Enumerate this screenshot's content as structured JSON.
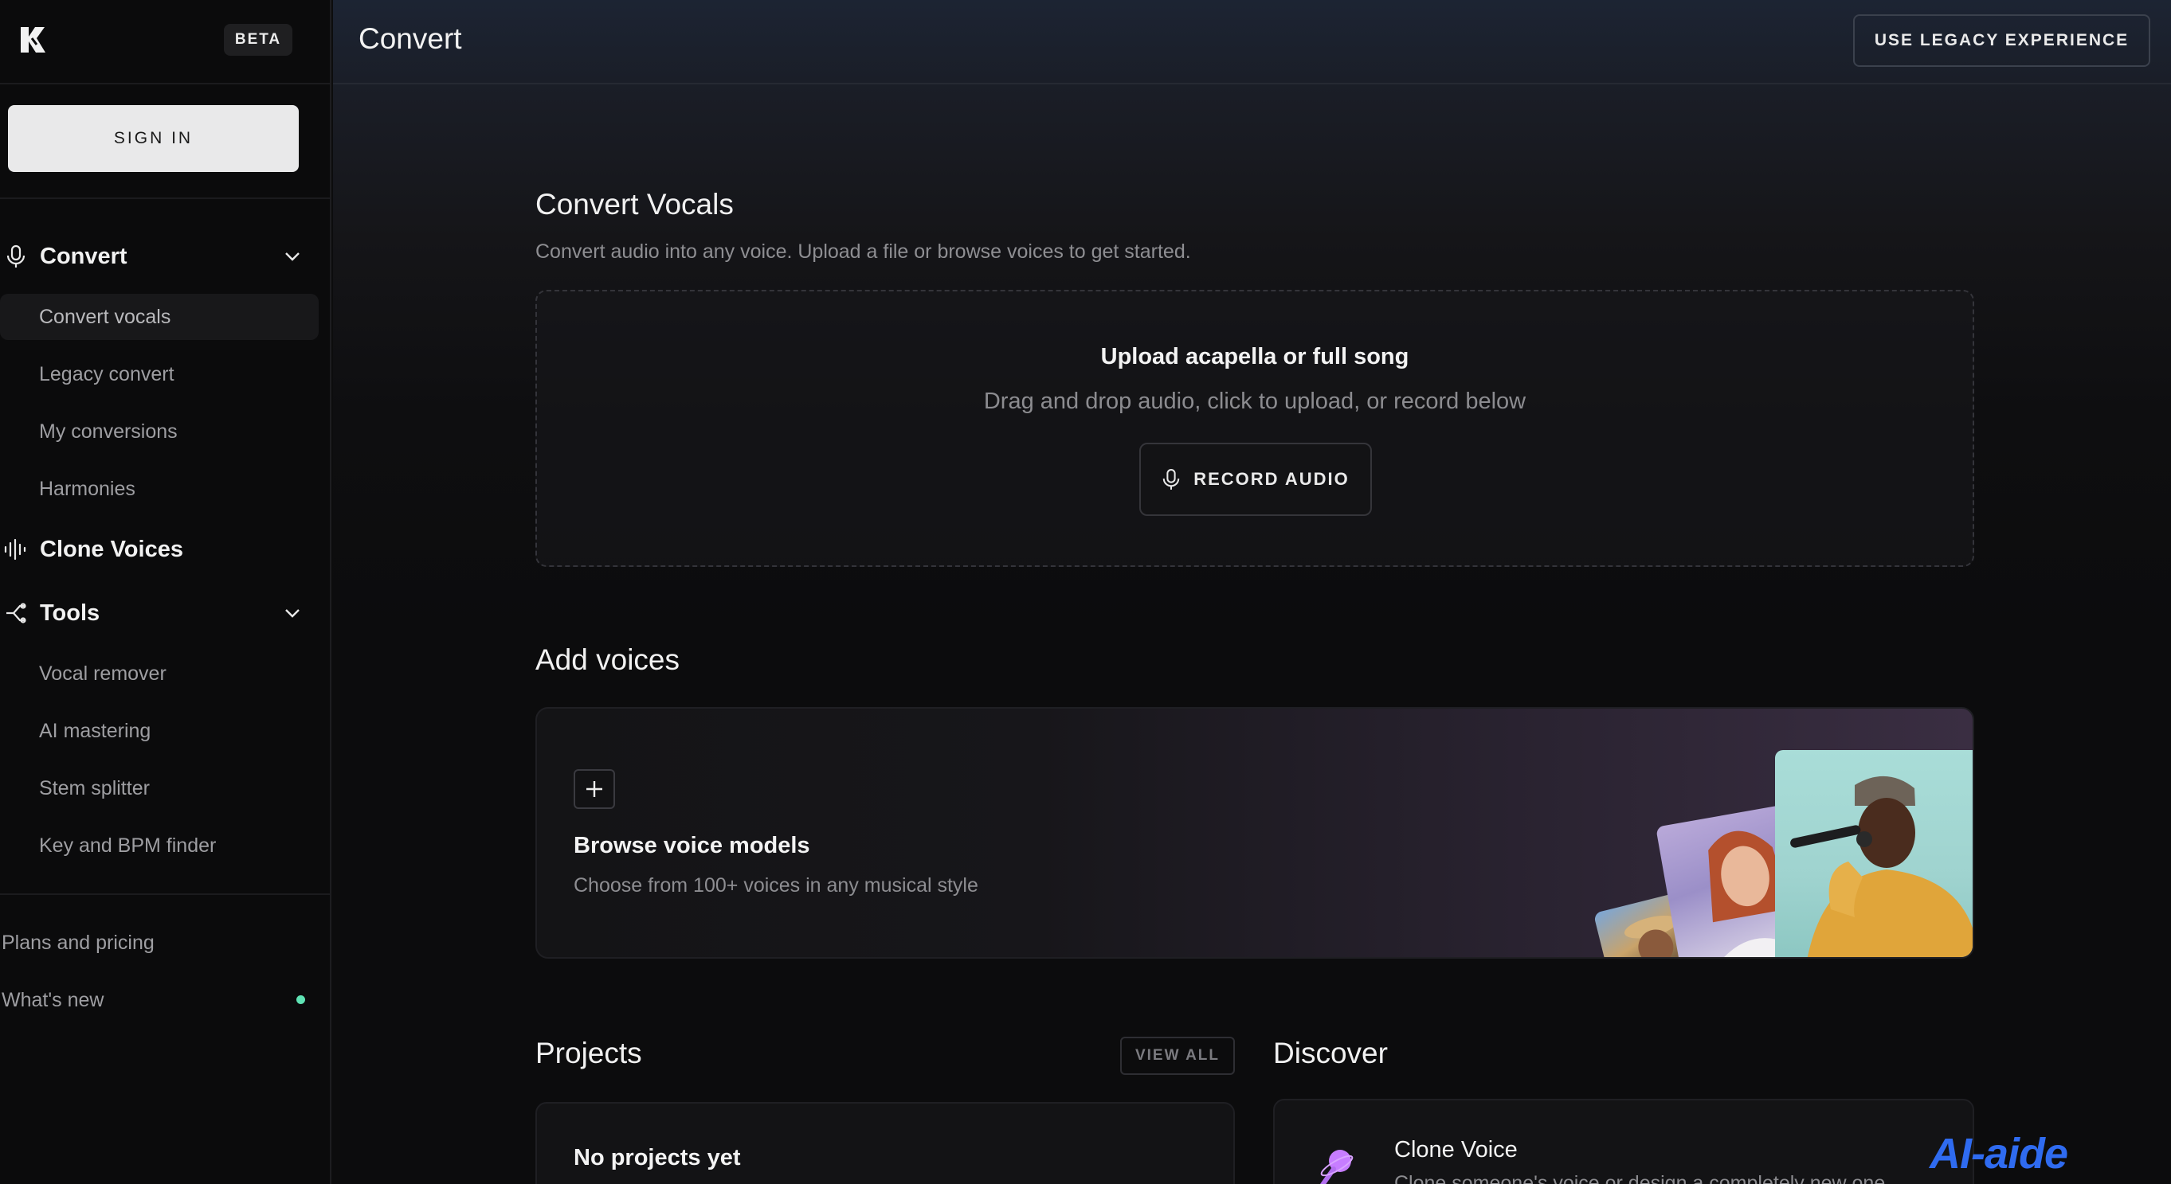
{
  "sidebar": {
    "beta_label": "BETA",
    "signin_label": "SIGN IN",
    "convert": {
      "label": "Convert",
      "items": [
        "Convert vocals",
        "Legacy convert",
        "My conversions",
        "Harmonies"
      ]
    },
    "clone_label": "Clone Voices",
    "tools": {
      "label": "Tools",
      "items": [
        "Vocal remover",
        "AI mastering",
        "Stem splitter",
        "Key and BPM finder"
      ]
    },
    "footer": {
      "plans": "Plans and pricing",
      "whats_new": "What's new"
    }
  },
  "header": {
    "title": "Convert",
    "legacy_button": "USE LEGACY EXPERIENCE"
  },
  "convert_vocals": {
    "title": "Convert Vocals",
    "subtitle": "Convert audio into any voice. Upload a file or browse voices to get started.",
    "upload_title": "Upload acapella or full song",
    "upload_subtitle": "Drag and drop audio, click to upload, or record below",
    "record_button": "RECORD AUDIO"
  },
  "add_voices": {
    "title": "Add voices",
    "card_title": "Browse voice models",
    "card_subtitle": "Choose from 100+ voices in any musical style"
  },
  "projects": {
    "title": "Projects",
    "view_all": "VIEW ALL",
    "empty_title": "No projects yet"
  },
  "discover": {
    "title": "Discover",
    "card_title": "Clone Voice",
    "card_subtitle": "Clone someone's voice or design a completely new one"
  },
  "watermark": "AI-aide",
  "colors": {
    "accent_dot": "#5fe3b4",
    "discover_icon": "#c77dff",
    "watermark": "#2f6bf0"
  },
  "icons": [
    "logo-icon",
    "mic-icon",
    "chevron-down-icon",
    "waveform-icon",
    "tools-icon",
    "plus-icon",
    "clone-voice-icon"
  ]
}
